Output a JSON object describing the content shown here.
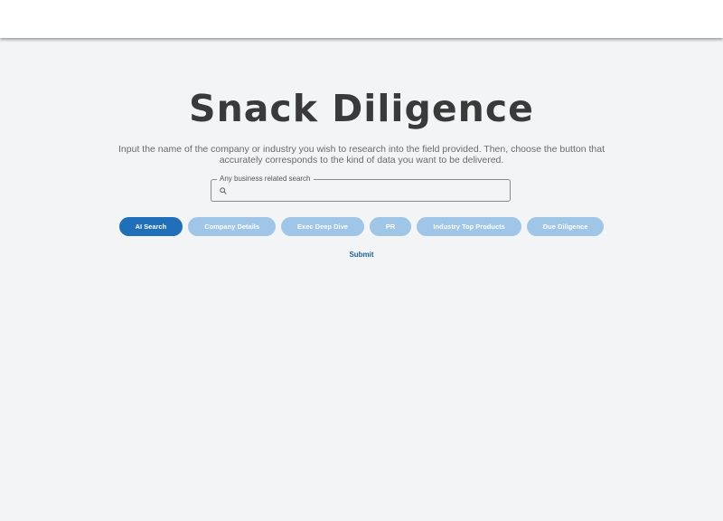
{
  "page": {
    "title": "Snack Diligence",
    "description": "Input the name of the company or industry you wish to research into the field provided. Then, choose the button that accurately corresponds to the kind of data you want to be delivered."
  },
  "search": {
    "label": "Any business related search",
    "value": "",
    "icon": "search-icon"
  },
  "chips": [
    {
      "label": "AI Search",
      "active": true
    },
    {
      "label": "Company Details",
      "active": false
    },
    {
      "label": "Exec Deep Dive",
      "active": false
    },
    {
      "label": "PR",
      "active": false
    },
    {
      "label": "Industry Top Products",
      "active": false
    },
    {
      "label": "Due Diligence",
      "active": false
    }
  ],
  "submit_label": "Submit",
  "colors": {
    "background": "#f2f4f6",
    "title": "#3a3a3a",
    "chip_active": "#1f6fb9",
    "chip_inactive": "#9fc5e7",
    "submit": "#1f5f93"
  }
}
